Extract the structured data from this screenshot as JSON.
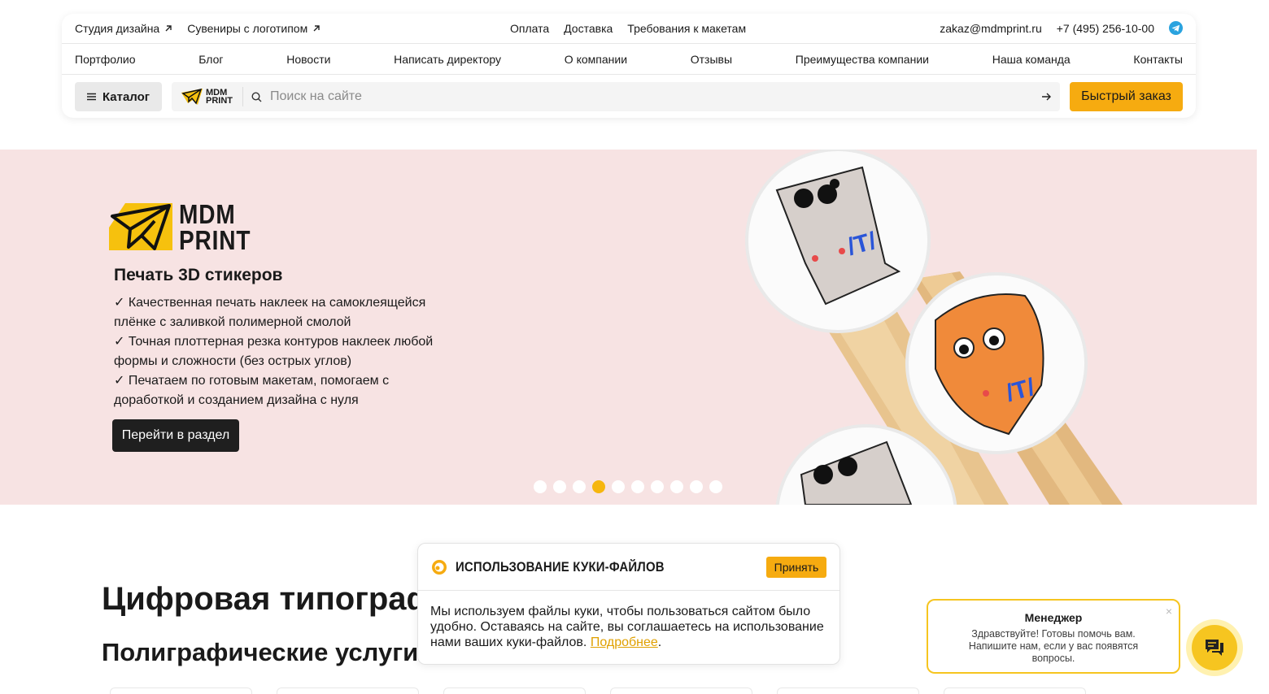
{
  "topbar": {
    "left_links": [
      "Студия дизайна",
      "Сувениры с логотипом"
    ],
    "center_links": [
      "Оплата",
      "Доставка",
      "Требования к макетам"
    ],
    "email": "zakaz@mdmprint.ru",
    "phone": "+7 (495) 256-10-00"
  },
  "nav": [
    "Портфолио",
    "Блог",
    "Новости",
    "Написать директору",
    "О компании",
    "Отзывы",
    "Преимущества компании",
    "Наша команда",
    "Контакты"
  ],
  "toolbar": {
    "catalog_label": "Каталог",
    "logo_line1": "MDM",
    "logo_line2": "PRINT",
    "search_placeholder": "Поиск на сайте",
    "quick_order_label": "Быстрый заказ"
  },
  "hero": {
    "logo_line1": "MDM",
    "logo_line2": "PRINT",
    "title": "Печать 3D стикеров",
    "bullets": [
      "✓ Качественная печать наклеек на самоклеящейся плёнке с заливкой полимерной смолой",
      "✓ Точная плоттерная резка контуров наклеек любой формы и сложности (без острых углов)",
      "✓ Печатаем по готовым макетам, помогаем с доработкой и созданием дизайна с нуля"
    ],
    "button_label": "Перейти в раздел",
    "slide_count": 10,
    "active_slide": 4,
    "badge_text": "/T/"
  },
  "page": {
    "heading": "Цифровая типография",
    "subheading": "Полиграфические услуги"
  },
  "cookie": {
    "title": "ИСПОЛЬЗОВАНИЕ КУКИ-ФАЙЛОВ",
    "accept_label": "Принять",
    "text": "Мы используем файлы куки, чтобы пользоваться сайтом было удобно. Оставаясь на сайте, вы соглашаетесь на использование нами ваших куки-файлов.",
    "link_label": "Подробнее",
    "suffix": "."
  },
  "chat": {
    "title": "Менеджер",
    "message": "Здравствуйте! Готовы помочь вам. Напишите нам, если у вас появятся вопросы.",
    "close": "×"
  },
  "colors": {
    "accent": "#f6ab10",
    "hero_bg": "#f7e3e3",
    "dark_button": "#1f1f1f",
    "telegram": "#2aa3df",
    "badge_orange": "#f08a3a",
    "badge_blue": "#2a55d8",
    "badge_red": "#e84a4a"
  },
  "icons": [
    "external-link-icon",
    "telegram-icon",
    "menu-icon",
    "search-icon",
    "arrow-right-icon",
    "paper-plane-logo-icon",
    "cookie-icon",
    "chat-icon"
  ]
}
